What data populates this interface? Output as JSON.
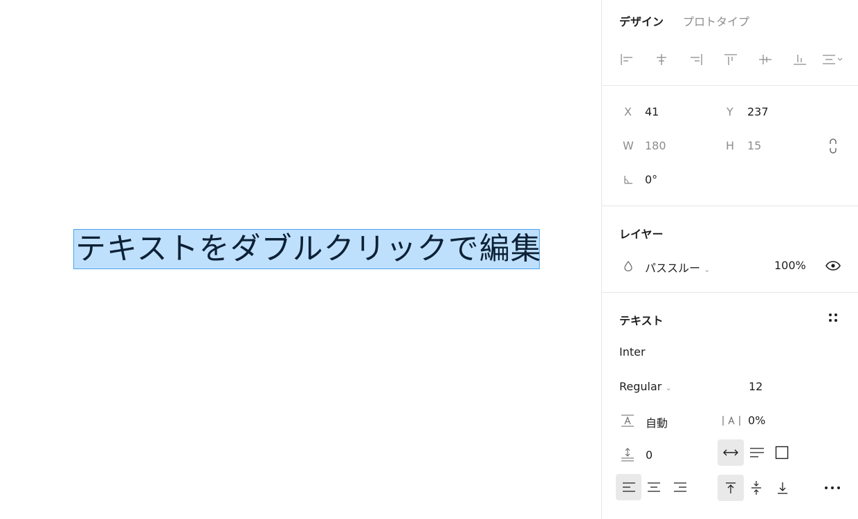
{
  "canvas": {
    "text_layer": "テキストをダブルクリックで編集"
  },
  "panel": {
    "tabs": [
      {
        "label": "デザイン",
        "active": true
      },
      {
        "label": "プロトタイプ",
        "active": false
      }
    ],
    "position": {
      "x_label": "X",
      "x_value": "41",
      "y_label": "Y",
      "y_value": "237",
      "w_label": "W",
      "w_value": "180",
      "h_label": "H",
      "h_value": "15",
      "rotation": "0°"
    },
    "layer": {
      "title": "レイヤー",
      "blend_mode": "パススルー",
      "opacity": "100%"
    },
    "text": {
      "title": "テキスト",
      "font_family": "Inter",
      "font_style": "Regular",
      "font_size": "12",
      "line_height": "自動",
      "letter_spacing": "0%",
      "paragraph_spacing": "0"
    },
    "icons": {
      "align": [
        "align-left-icon",
        "align-horizontal-center-icon",
        "align-right-icon",
        "align-top-icon",
        "align-vertical-center-icon",
        "align-bottom-icon",
        "distribute-icon"
      ],
      "constrain": "constrain-proportions-icon",
      "blend": "blend-mode-icon",
      "visibility": "eye-icon",
      "text_settings": "type-settings-icon"
    }
  }
}
